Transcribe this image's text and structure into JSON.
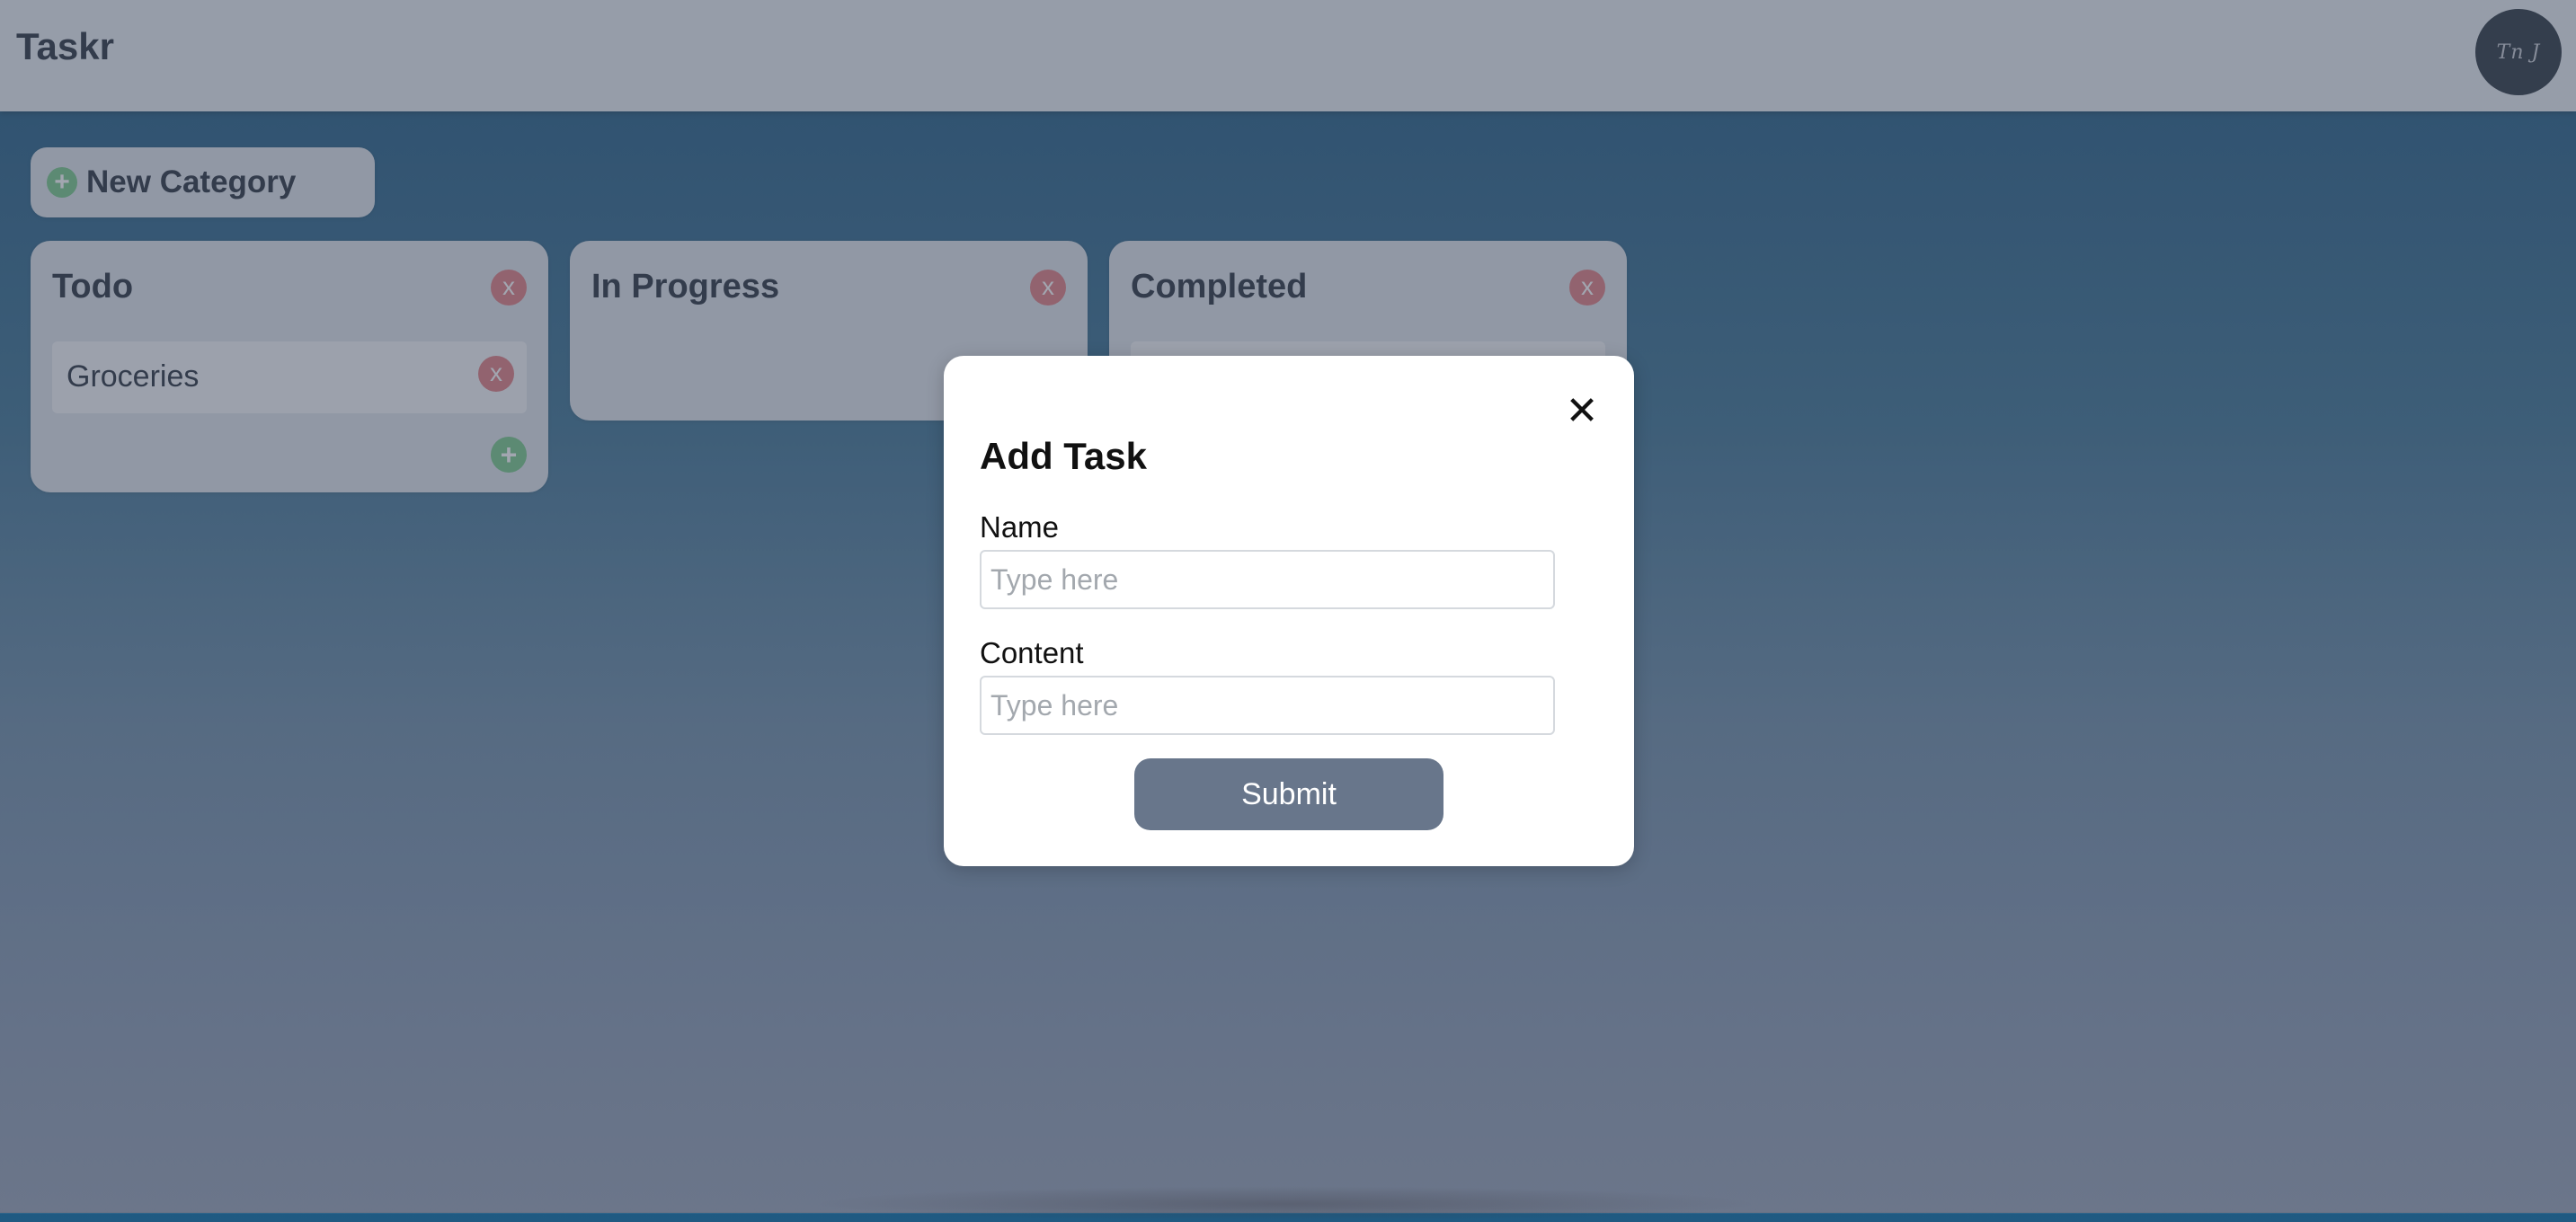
{
  "app": {
    "title": "Taskr",
    "avatar_text": "Tn J"
  },
  "toolbar": {
    "new_category_label": "New Category",
    "plus_glyph": "+"
  },
  "columns": [
    {
      "title": "Todo",
      "delete_glyph": "x",
      "tasks": [
        {
          "name": "Groceries",
          "delete_glyph": "x"
        }
      ],
      "add_glyph": "+"
    },
    {
      "title": "In Progress",
      "delete_glyph": "x",
      "tasks": []
    },
    {
      "title": "Completed",
      "delete_glyph": "x",
      "tasks": []
    }
  ],
  "modal": {
    "title": "Add Task",
    "close_glyph": "✕",
    "name_label": "Name",
    "name_placeholder": "Type here",
    "content_label": "Content",
    "content_placeholder": "Type here",
    "submit_label": "Submit"
  },
  "colors": {
    "accent_green": "#79c98a",
    "delete_red": "#e07f82",
    "submit_button": "#68768b",
    "avatar_bg": "#2d3842"
  }
}
